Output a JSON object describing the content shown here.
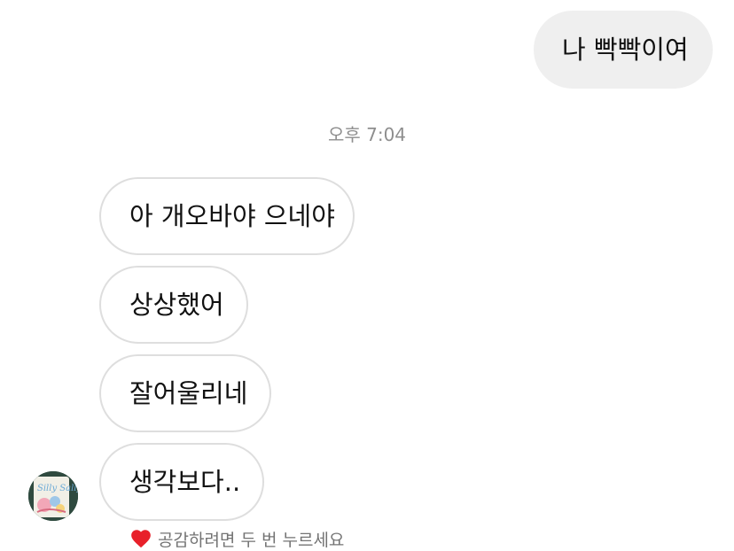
{
  "messages": {
    "outgoing": [
      {
        "text": "나 빡빡이여"
      }
    ],
    "timestamp": "오후 7:04",
    "incoming": [
      {
        "text": "아 개오바야 으네야"
      },
      {
        "text": "상상했어"
      },
      {
        "text": "잘어울리네"
      },
      {
        "text": "생각보다.."
      }
    ]
  },
  "reaction_hint": {
    "icon": "heart-icon",
    "text": "공감하려면 두 번 누르세요"
  },
  "avatar": {
    "icon": "user-avatar"
  },
  "colors": {
    "outgoing_bubble": "#efefef",
    "incoming_border": "#dedede",
    "timestamp_text": "#8e8e8e",
    "hint_text": "#737373",
    "heart": "#e8202a"
  }
}
